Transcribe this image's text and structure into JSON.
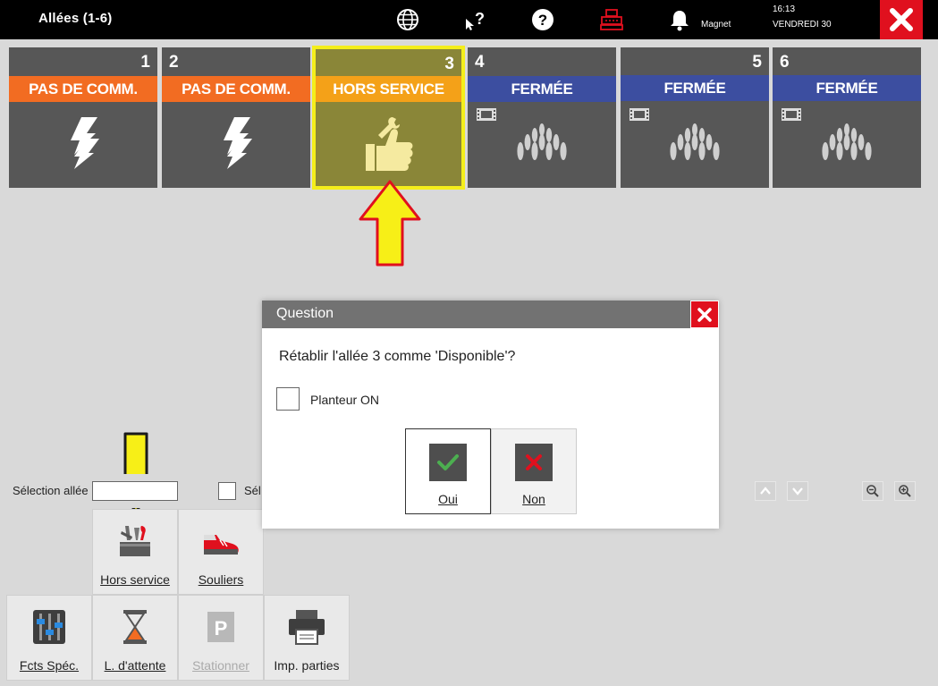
{
  "header": {
    "title": "Allées (1-6)",
    "user": "Magnet",
    "time": "16:13",
    "date": "VENDREDI 30"
  },
  "lanes": [
    {
      "number": "1",
      "status": "PAS DE COMM."
    },
    {
      "number": "2",
      "status": "PAS DE COMM."
    },
    {
      "number": "3",
      "status": "HORS SERVICE"
    },
    {
      "number": "4",
      "status": "FERMÉE"
    },
    {
      "number": "5",
      "status": "FERMÉE"
    },
    {
      "number": "6",
      "status": "FERMÉE"
    }
  ],
  "dialog": {
    "title": "Question",
    "message": "Rétablir l'allée 3 comme 'Disponible'?",
    "checkbox_label": "Planteur ON",
    "yes_label": "Oui",
    "no_label": "Non"
  },
  "selection": {
    "label": "Sélection allée",
    "check_label": "Sél"
  },
  "tools": {
    "hors_service": "Hors service",
    "souliers": "Souliers",
    "fcts_spec": "Fcts Spéc.",
    "attente": "L. d'attente",
    "stationner": "Stationner",
    "imp_parties": "Imp. parties"
  },
  "colors": {
    "status_orange": "#f26c22",
    "status_blue": "#3c4ea0",
    "status_amber": "#f4a118",
    "highlight_yellow": "#f4ee1b",
    "close_red": "#e0101e"
  }
}
